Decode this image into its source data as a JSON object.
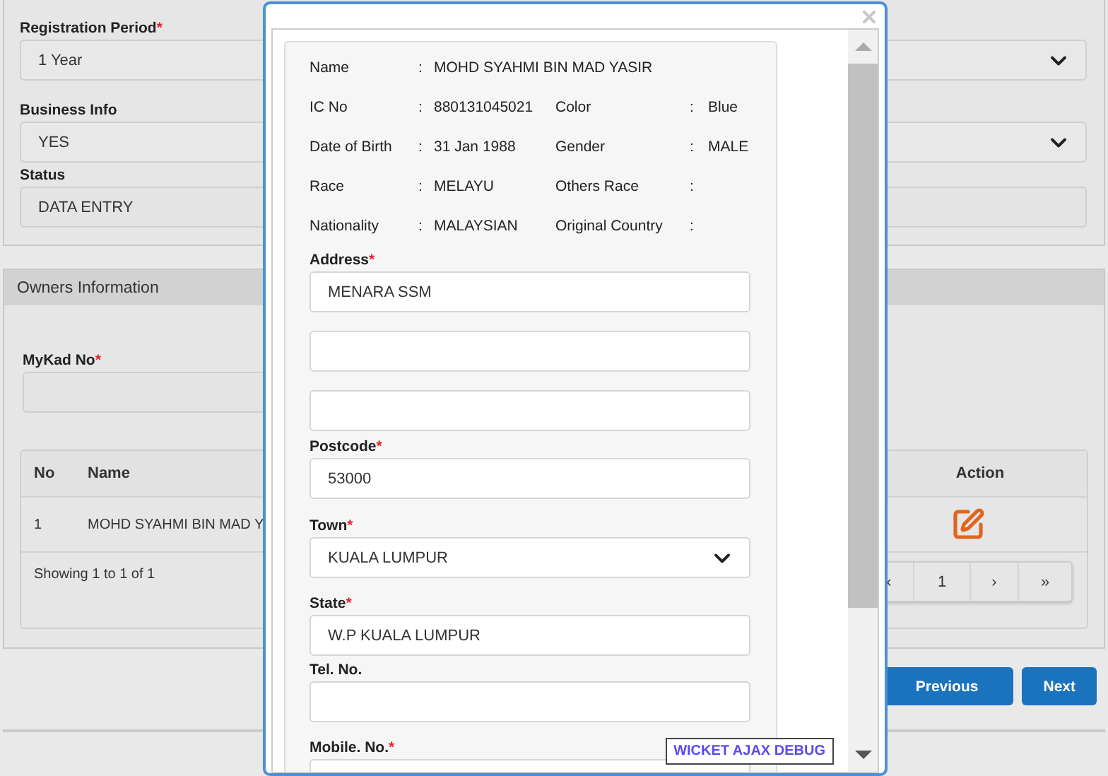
{
  "top_form": {
    "fields": [
      {
        "label": "Registration Period",
        "mark": "*",
        "kind": "select",
        "value": "1 Year"
      },
      {
        "label": "Business Info",
        "kind": "select",
        "value": "YES"
      },
      {
        "label": "Status",
        "kind": "text",
        "value": "DATA ENTRY"
      }
    ]
  },
  "owners": {
    "title": "Owners Information",
    "mykad": {
      "label": "MyKad No",
      "mark": "*"
    },
    "table": {
      "columns": [
        "No",
        "Name",
        "Action"
      ],
      "rows": [
        {
          "no": "1",
          "name": "MOHD SYAHMI BIN MAD Y"
        }
      ],
      "footer": "Showing 1 to 1 of 1",
      "pages": [
        "‹",
        "1",
        "›",
        "»"
      ]
    }
  },
  "buttons": [
    "Previous",
    "Next"
  ],
  "modal": {
    "info": [
      [
        {
          "label": "Name",
          "colon": ":",
          "value": "MOHD SYAHMI BIN MAD YASIR"
        }
      ],
      [
        {
          "label": "IC No",
          "colon": ":",
          "value": "880131045021"
        },
        {
          "label": "Color",
          "colon": ":",
          "value": "Blue"
        }
      ],
      [
        {
          "label": "Date of Birth",
          "colon": ":",
          "value": "31 Jan 1988"
        },
        {
          "label": "Gender",
          "colon": ":",
          "value": "MALE"
        }
      ],
      [
        {
          "label": "Race",
          "colon": ":",
          "value": "MELAYU"
        },
        {
          "label": "Others Race",
          "colon": ":"
        }
      ],
      [
        {
          "label": "Nationality",
          "colon": ":",
          "value": "MALAYSIAN"
        },
        {
          "label": "Original Country",
          "colon": ":"
        }
      ]
    ],
    "fields": [
      {
        "label": "Address",
        "mark": "*",
        "kind": "text",
        "value": "MENARA SSM"
      },
      {
        "kind": "text"
      },
      {
        "kind": "text"
      },
      {
        "label": "Postcode",
        "mark": "*",
        "kind": "text",
        "value": "53000"
      },
      {
        "label": "Town",
        "mark": "*",
        "kind": "select",
        "value": "KUALA LUMPUR"
      },
      {
        "label": "State",
        "mark": "*",
        "kind": "text",
        "value": "W.P KUALA LUMPUR"
      },
      {
        "label": "Tel. No.",
        "kind": "text"
      },
      {
        "label": "Mobile. No.",
        "mark": "*",
        "kind": "text"
      }
    ],
    "debug_link": "WICKET AJAX DEBUG"
  }
}
